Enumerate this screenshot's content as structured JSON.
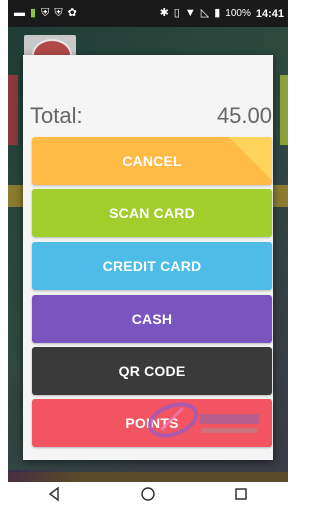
{
  "status_bar": {
    "left_icons": [
      "screenshot-icon",
      "battery-saver-icon",
      "shield-icon",
      "shield-icon",
      "settings-icon"
    ],
    "right_icons": [
      "bluetooth-icon",
      "vibrate-icon",
      "wifi-icon",
      "no-signal-icon",
      "battery-icon"
    ],
    "battery_percent": "100%",
    "time": "14:41"
  },
  "modal": {
    "total_label": "Total:",
    "total_amount": "45.00",
    "buttons": [
      {
        "label": "CANCEL",
        "color": "#ffbb45"
      },
      {
        "label": "SCAN CARD",
        "color": "#a2ce2b"
      },
      {
        "label": "CREDIT CARD",
        "color": "#4dbde8"
      },
      {
        "label": "CASH",
        "color": "#7a55bf"
      },
      {
        "label": "QR CODE",
        "color": "#3a3a3a"
      },
      {
        "label": "POINTS",
        "color": "#f25461"
      }
    ]
  },
  "background_nav": {
    "icons": [
      "home-icon",
      "document-icon",
      "chart-icon",
      "register-icon",
      "plus-icon"
    ]
  },
  "android_nav": {
    "icons": [
      "back-icon",
      "home-circle-icon",
      "recents-icon"
    ]
  }
}
